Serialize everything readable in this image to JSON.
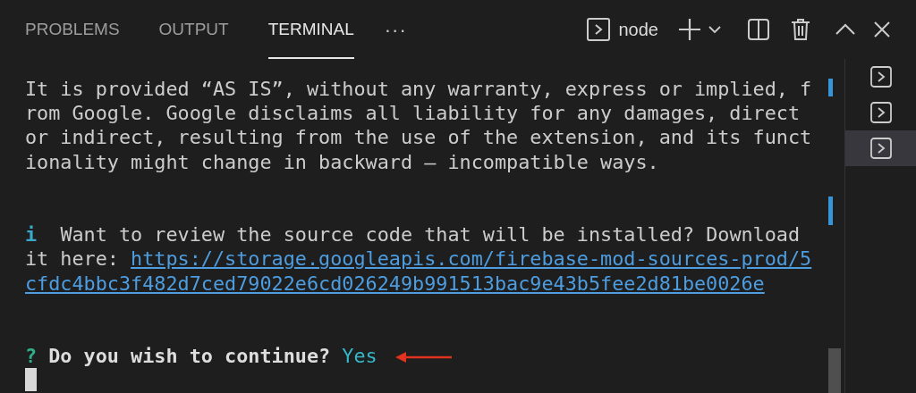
{
  "panel_tabs": [
    {
      "label": "PROBLEMS",
      "selected": false
    },
    {
      "label": "OUTPUT",
      "selected": false
    },
    {
      "label": "TERMINAL",
      "selected": true
    }
  ],
  "more": "···",
  "terminal_name": "node",
  "terminal": {
    "lines": [
      {
        "kind": "text",
        "text": "It is provided “AS IS”, without any warranty, express or implied, f"
      },
      {
        "kind": "text",
        "text": "rom Google. Google disclaims all liability for any damages, direct"
      },
      {
        "kind": "text",
        "text": "or indirect, resulting from the use of the extension, and its funct"
      },
      {
        "kind": "text",
        "text": "ionality might change in backward – incompatible ways."
      },
      {
        "kind": "blank"
      },
      {
        "kind": "blank"
      },
      {
        "kind": "info",
        "mark": "i",
        "text": "Want to review the source code that will be installed? Download"
      },
      {
        "kind": "link",
        "prefix": "it here: ",
        "link": "https://storage.googleapis.com/firebase-mod-sources-prod/5"
      },
      {
        "kind": "link",
        "link": "cfdc4bbc3f482d7ced79022e6cd026249b991513bac9e43b5fee2d81be0026e"
      },
      {
        "kind": "blank"
      },
      {
        "kind": "blank"
      },
      {
        "kind": "prompt",
        "mark": "?",
        "text": "Do you wish to continue?",
        "answer": "Yes"
      },
      {
        "kind": "cursor"
      }
    ]
  },
  "terminal_list": [
    {
      "selected": false
    },
    {
      "selected": false
    },
    {
      "selected": true
    }
  ]
}
